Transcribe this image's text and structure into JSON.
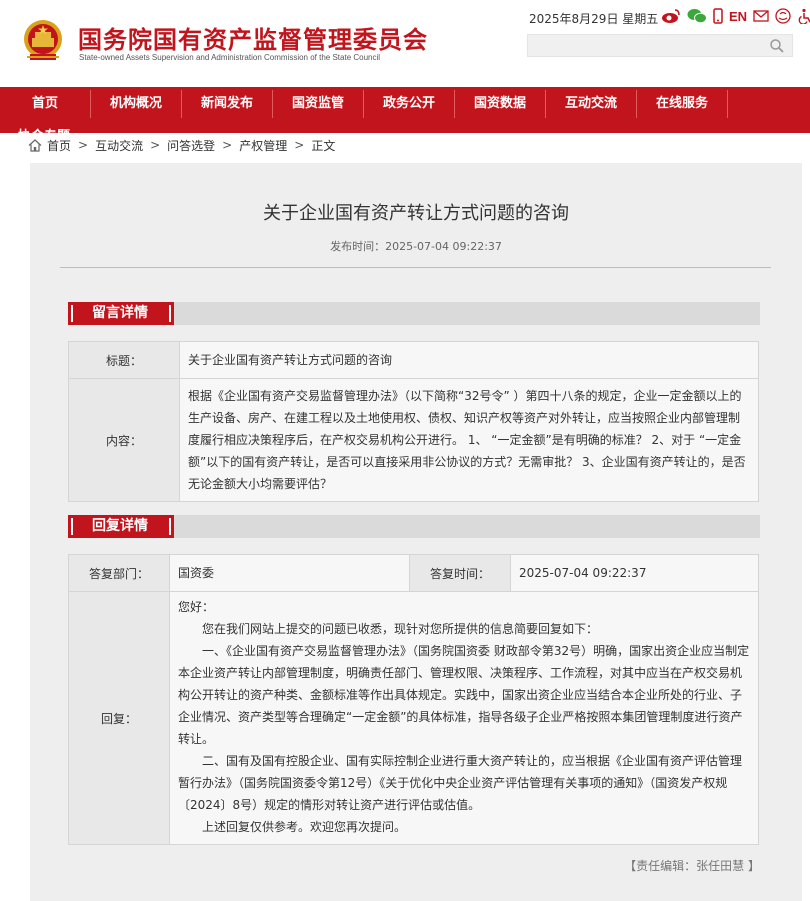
{
  "header": {
    "site_name": "国务院国有资产监督管理委员会",
    "site_name_en": "State-owned Assets Supervision and Administration Commission of the State Council",
    "date": "2025年8月29日  星期五",
    "en_label": "EN"
  },
  "nav": {
    "items": [
      "首页",
      "机构概况",
      "新闻发布",
      "国资监管",
      "政务公开",
      "国资数据",
      "互动交流",
      "在线服务"
    ],
    "overflow_text": "协会专题"
  },
  "breadcrumb": [
    "首页",
    "互动交流",
    "问答选登",
    "产权管理",
    "正文"
  ],
  "article": {
    "title": "关于企业国有资产转让方式问题的咨询",
    "publish_time": "发布时间：2025-07-04 09:22:37"
  },
  "message": {
    "section_label": "留言详情",
    "title_label": "标题：",
    "title_value": "关于企业国有资产转让方式问题的咨询",
    "content_label": "内容：",
    "content_value": "根据《企业国有资产交易监督管理办法》（以下简称“32号令” ）第四十八条的规定，企业一定金额以上的生产设备、房产、在建工程以及土地使用权、债权、知识产权等资产对外转让，应当按照企业内部管理制度履行相应决策程序后，在产权交易机构公开进行。 1、 “一定金额”是有明确的标准？ 2、对于 “一定金额”以下的国有资产转让，是否可以直接采用非公协议的方式？无需审批？ 3、企业国有资产转让的，是否无论金额大小均需要评估？"
  },
  "reply": {
    "section_label": "回复详情",
    "dept_label": "答复部门：",
    "dept_value": "国资委",
    "time_label": "答复时间：",
    "time_value": "2025-07-04 09:22:37",
    "reply_label": "回复：",
    "greeting": "您好：",
    "paragraphs": [
      "您在我们网站上提交的问题已收悉，现针对您所提供的信息简要回复如下：",
      "一、《企业国有资产交易监督管理办法》（国务院国资委 财政部令第32号）明确，国家出资企业应当制定本企业资产转让内部管理制度，明确责任部门、管理权限、决策程序、工作流程，对其中应当在产权交易机构公开转让的资产种类、金额标准等作出具体规定。实践中，国家出资企业应当结合本企业所处的行业、子企业情况、资产类型等合理确定“一定金额”的具体标准，指导各级子企业严格按照本集团管理制度进行资产转让。",
      "二、国有及国有控股企业、国有实际控制企业进行重大资产转让的，应当根据《企业国有资产评估管理暂行办法》（国务院国资委令第12号）《关于优化中央企业资产评估管理有关事项的通知》（国资发产权规〔2024〕8号）规定的情形对转让资产进行评估或估值。",
      "上述回复仅供参考。欢迎您再次提问。"
    ]
  },
  "editor": "【责任编辑：张任田慧 】",
  "colors": {
    "brand_red": "#c1141c",
    "panel_gray": "#eeeeee"
  }
}
